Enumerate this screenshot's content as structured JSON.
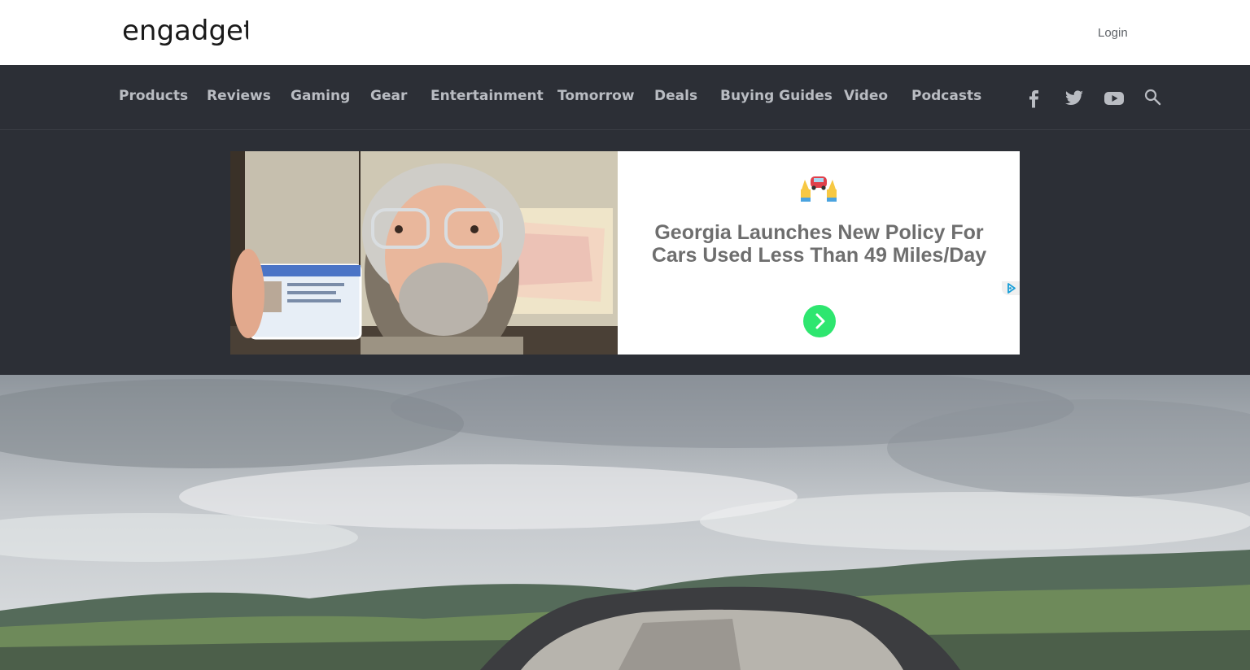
{
  "header": {
    "logo_text": "engadget",
    "login_label": "Login"
  },
  "nav": {
    "items": [
      "Products",
      "Reviews",
      "Gaming",
      "Gear",
      "Entertainment",
      "Tomorrow",
      "Deals",
      "Buying Guides",
      "Video",
      "Podcasts"
    ],
    "icons": [
      "facebook-icon",
      "twitter-icon",
      "youtube-icon",
      "search-icon"
    ]
  },
  "ad": {
    "headline": "Georgia Launches New Policy For Cars Used Less Than 49 Miles/Day",
    "cta_icon": "chevron-right-icon",
    "badge_icon": "adchoices-icon",
    "accent": "#2ee66f"
  },
  "hero": {
    "image_icon": "car-landscape-photo"
  },
  "colors": {
    "nav_bg": "#2c2f36",
    "nav_text": "#b9bcc2",
    "page_bg": "#ffffff"
  }
}
